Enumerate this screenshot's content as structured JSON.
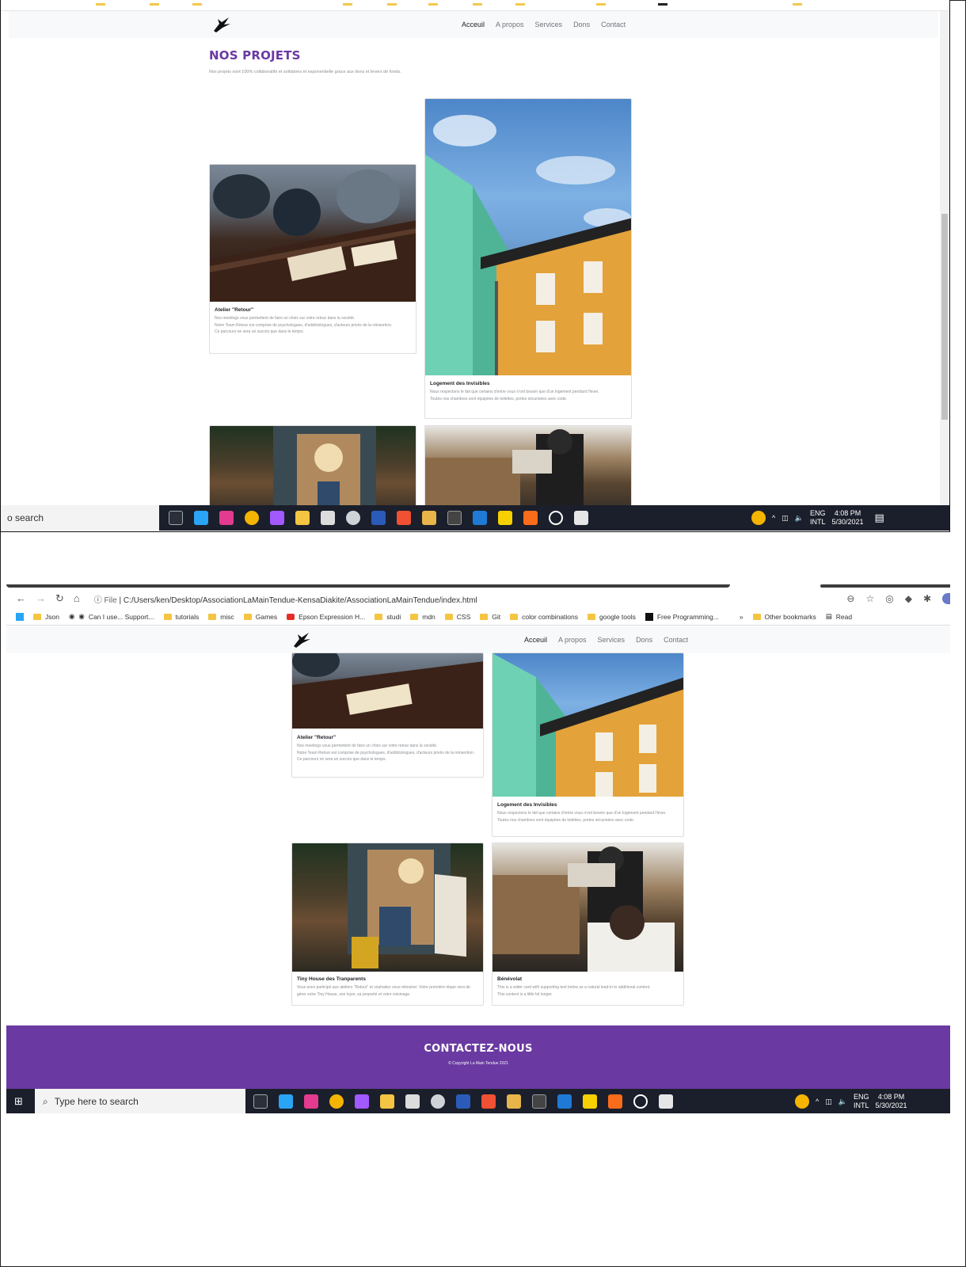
{
  "site": {
    "nav": [
      "Acceuil",
      "A propos",
      "Services",
      "Dons",
      "Contact"
    ],
    "section_title": "NOS PROJETS",
    "section_subtitle": "Nos projets sont 100% collaboratifs et solidaires et exponentielle grace aux dons et levers de fonds.",
    "cards": [
      {
        "title": "Atelier \"Retour\"",
        "lines": [
          "Nos meetings vous permettent de faire un choix sur votre retour dans la société.",
          "Notre Team Retour est comprise de psychologues, d'addictologues, d'acteurs privés de la réinsertion.",
          "Ce parcours ne sera un succès que dans le temps."
        ]
      },
      {
        "title": "Logement des Invisibles",
        "lines": [
          "Nous respectons le fait que certains d'entre vous n'ont besoin que d'un logement pendant l'hiver.",
          "Toutes nos chambres sont équipées de toilettes, portes sécurisées avec code."
        ]
      },
      {
        "title": "Tiny House des Tranparents",
        "lines": [
          "Vous avez participé aux ateliers \"Retour\" et souhaitez vous réinsérer. Votre première étape sera de gérer votre Tiny House, son loyer, sa propreté et votre voisinage."
        ]
      },
      {
        "title": "Bénévolat",
        "lines": [
          "This is a wider card with supporting text below as a natural lead-in to additional content.",
          "This content is a little bit longer."
        ]
      }
    ],
    "footer_title": "CONTACTEZ-NOUS",
    "footer_copy": "© Copyright La Main Tendue 2021",
    "brand_color": "#6a3aa2"
  },
  "taskbar": {
    "search_partial": "o search",
    "search_placeholder": "Type here to search",
    "lang_top": "ENG",
    "lang_bottom": "INTL",
    "time": "4:08 PM",
    "date": "5/30/2021"
  },
  "browser": {
    "file_label": "File",
    "url": "C:/Users/ken/Desktop/AssociationLaMainTendue-KensaDiakite/AssociationLaMainTendue/index.html",
    "bookmarks": [
      "Json",
      "Can I use... Support...",
      "tutorials",
      "misc",
      "Games",
      "Epson Expression H...",
      "studi",
      "mdn",
      "CSS",
      "Git",
      "color combinations",
      "google tools",
      "Free Programming..."
    ],
    "more": "»",
    "other_bookmarks": "Other bookmarks",
    "reading": "Read"
  }
}
